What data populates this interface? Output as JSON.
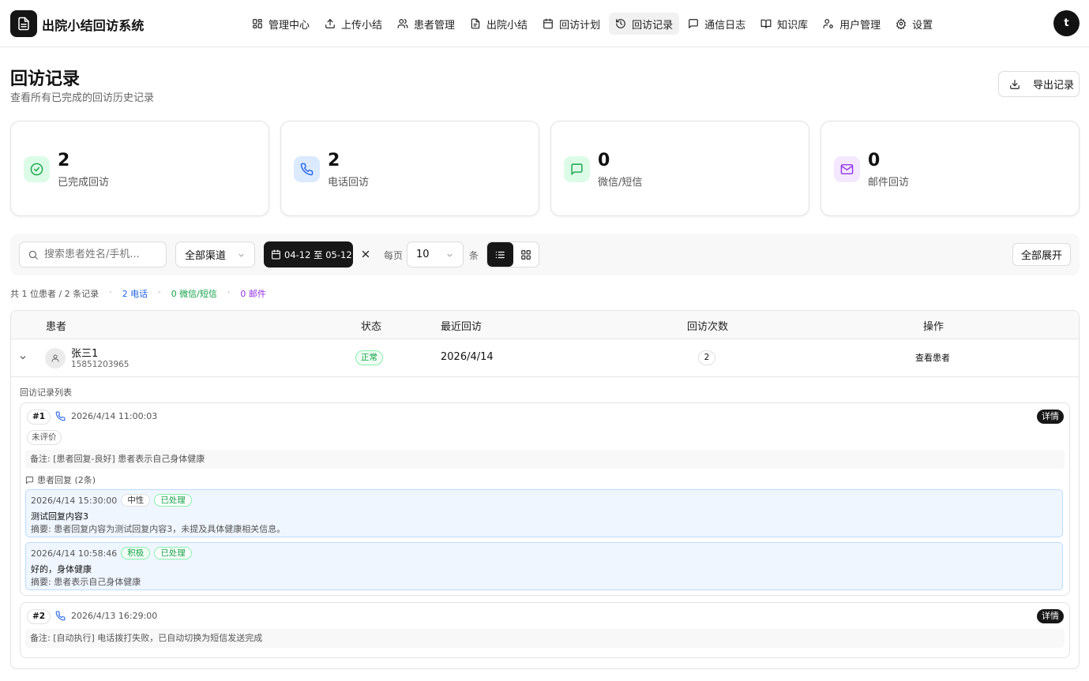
{
  "app": {
    "title": "出院小结回访系统",
    "user_initial": "t"
  },
  "nav": [
    {
      "label": "管理中心",
      "icon": "dashboard-icon"
    },
    {
      "label": "上传小结",
      "icon": "upload-icon"
    },
    {
      "label": "患者管理",
      "icon": "users-icon"
    },
    {
      "label": "出院小结",
      "icon": "file-icon"
    },
    {
      "label": "回访计划",
      "icon": "calendar-icon"
    },
    {
      "label": "回访记录",
      "icon": "history-icon",
      "active": true
    },
    {
      "label": "通信日志",
      "icon": "message-icon"
    },
    {
      "label": "知识库",
      "icon": "book-icon"
    },
    {
      "label": "用户管理",
      "icon": "user-cog-icon"
    },
    {
      "label": "设置",
      "icon": "gear-icon"
    }
  ],
  "header": {
    "title": "回访记录",
    "subtitle": "查看所有已完成的回访历史记录",
    "export_label": "导出记录"
  },
  "stats": [
    {
      "value": "2",
      "label": "已完成回访",
      "color": "#16a34a",
      "bg": "#dcfce7",
      "icon": "check-circle-icon"
    },
    {
      "value": "2",
      "label": "电话回访",
      "color": "#2563eb",
      "bg": "#dbeafe",
      "icon": "phone-icon"
    },
    {
      "value": "0",
      "label": "微信/短信",
      "color": "#16a34a",
      "bg": "#dcfce7",
      "icon": "chat-icon"
    },
    {
      "value": "0",
      "label": "邮件回访",
      "color": "#9333ea",
      "bg": "#f3e8ff",
      "icon": "mail-icon"
    }
  ],
  "filters": {
    "search_placeholder": "搜索患者姓名/手机...",
    "channel": "全部渠道",
    "date_range": "04-12 至 05-12",
    "per_page_label": "每页",
    "per_page": "10",
    "per_page_unit": "条",
    "expand_all": "全部展开"
  },
  "summary": {
    "total": "共 1 位患者 / 2 条记录",
    "phone": "2 电话",
    "wechat": "0 微信/短信",
    "email": "0 邮件"
  },
  "table": {
    "headers": {
      "patient": "患者",
      "status": "状态",
      "last_visit": "最近回访",
      "count": "回访次数",
      "actions": "操作"
    },
    "row": {
      "name": "张三1",
      "phone": "15851203965",
      "status": "正常",
      "last_visit": "2026/4/14",
      "count": "2",
      "action": "查看患者"
    },
    "list_title": "回访记录列表",
    "records": [
      {
        "num": "#1",
        "time": "2026/4/14 11:00:03",
        "detail": "详情",
        "evaluation": "未评价",
        "note": "备注: [患者回复-良好] 患者表示自己身体健康",
        "reply_header": "患者回复 (2条)",
        "replies": [
          {
            "time": "2026/4/14 15:30:00",
            "sentiment": "中性",
            "state": "已处理",
            "content": "测试回复内容3",
            "summary": "摘要: 患者回复内容为测试回复内容3，未提及具体健康相关信息。"
          },
          {
            "time": "2026/4/14 10:58:46",
            "sentiment": "积极",
            "state": "已处理",
            "content": "好的，身体健康",
            "summary": "摘要: 患者表示自己身体健康"
          }
        ]
      },
      {
        "num": "#2",
        "time": "2026/4/13 16:29:00",
        "detail": "详情",
        "note": "备注: [自动执行] 电话拨打失败，已自动切换为短信发送完成"
      }
    ]
  }
}
